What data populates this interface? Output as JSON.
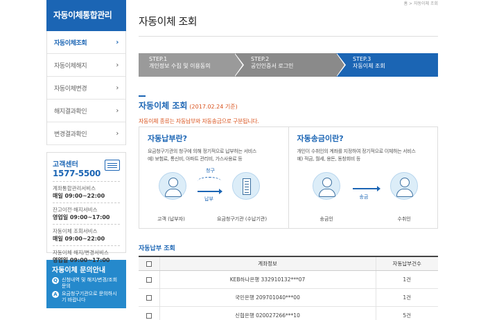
{
  "breadcrumb": "홈 > 자동이체 조회",
  "sidebar": {
    "title": "자동이체통합관리",
    "items": [
      {
        "label": "자동이체조회",
        "active": true
      },
      {
        "label": "자동이체해지"
      },
      {
        "label": "자동이체변경"
      },
      {
        "label": "해지결과확인"
      },
      {
        "label": "변경결과확인"
      }
    ],
    "customer_center": {
      "title": "고객센터",
      "phone": "1577-5500",
      "hours": [
        {
          "label": "계좌통합관리서비스",
          "time": "매일 09:00~22:00"
        },
        {
          "label": "잔고이전·해지서비스",
          "time": "영업일 09:00~17:00"
        },
        {
          "label": "자동이체 조회서비스",
          "time": "매일 09:00~22:00"
        },
        {
          "label": "자동이체 해지/변경서비스",
          "time": "영업일 09:00~17:00"
        }
      ]
    },
    "inquiry": {
      "title": "자동이체 문의안내",
      "rows": [
        {
          "badge": "Q",
          "text": "신청내역 및 해지/변경/조회 문의"
        },
        {
          "badge": "A",
          "text": "요금청구기관으로 문의하시기 바랍니다"
        }
      ]
    }
  },
  "page_title": "자동이체 조회",
  "steps": [
    {
      "num": "STEP.1",
      "label": "개인정보 수집 및 이용동의"
    },
    {
      "num": "STEP.2",
      "label": "공인인증서 로그인"
    },
    {
      "num": "STEP.3",
      "label": "자동이체 조회"
    }
  ],
  "section": {
    "title": "자동이체 조회",
    "date": "(2017.02.24 기준)",
    "notice": "자동이체 종류는 자동납부와 자동송금으로 구분됩니다."
  },
  "auto_payment": {
    "heading": "자동납부란?",
    "desc_line1": "요금청구기관의 청구에 의해 정기적으로 납부하는 서비스",
    "desc_line2": "예) 보험료, 통신비, 아파트 관리비, 가스사용료 등",
    "claim_label": "청구",
    "pay_label": "납부",
    "left_caption": "고객 (납부자)",
    "right_caption": "요금청구기관 (수납기관)"
  },
  "auto_transfer": {
    "heading": "자동송금이란?",
    "desc_line1": "개인이 수취인의 계좌를 지정하여 정기적으로 이체하는 서비스",
    "desc_line2": "예) 적금, 월세, 용돈, 동창회비 등",
    "send_label": "송금",
    "left_caption": "송금인",
    "right_caption": "수취인"
  },
  "list": {
    "title": "자동납부 조회",
    "headers": [
      "계좌정보",
      "자동납부건수"
    ],
    "rows": [
      {
        "account": "KEB하나은행 332910132***07",
        "count": "1건"
      },
      {
        "account": "국민은행 209701040***00",
        "count": "1건"
      },
      {
        "account": "신협은행 020027266***10",
        "count": "5건"
      }
    ]
  },
  "colors": {
    "primary": "#1b65b4",
    "accent": "#d9531e",
    "step_inactive": "#9a9a9a"
  }
}
